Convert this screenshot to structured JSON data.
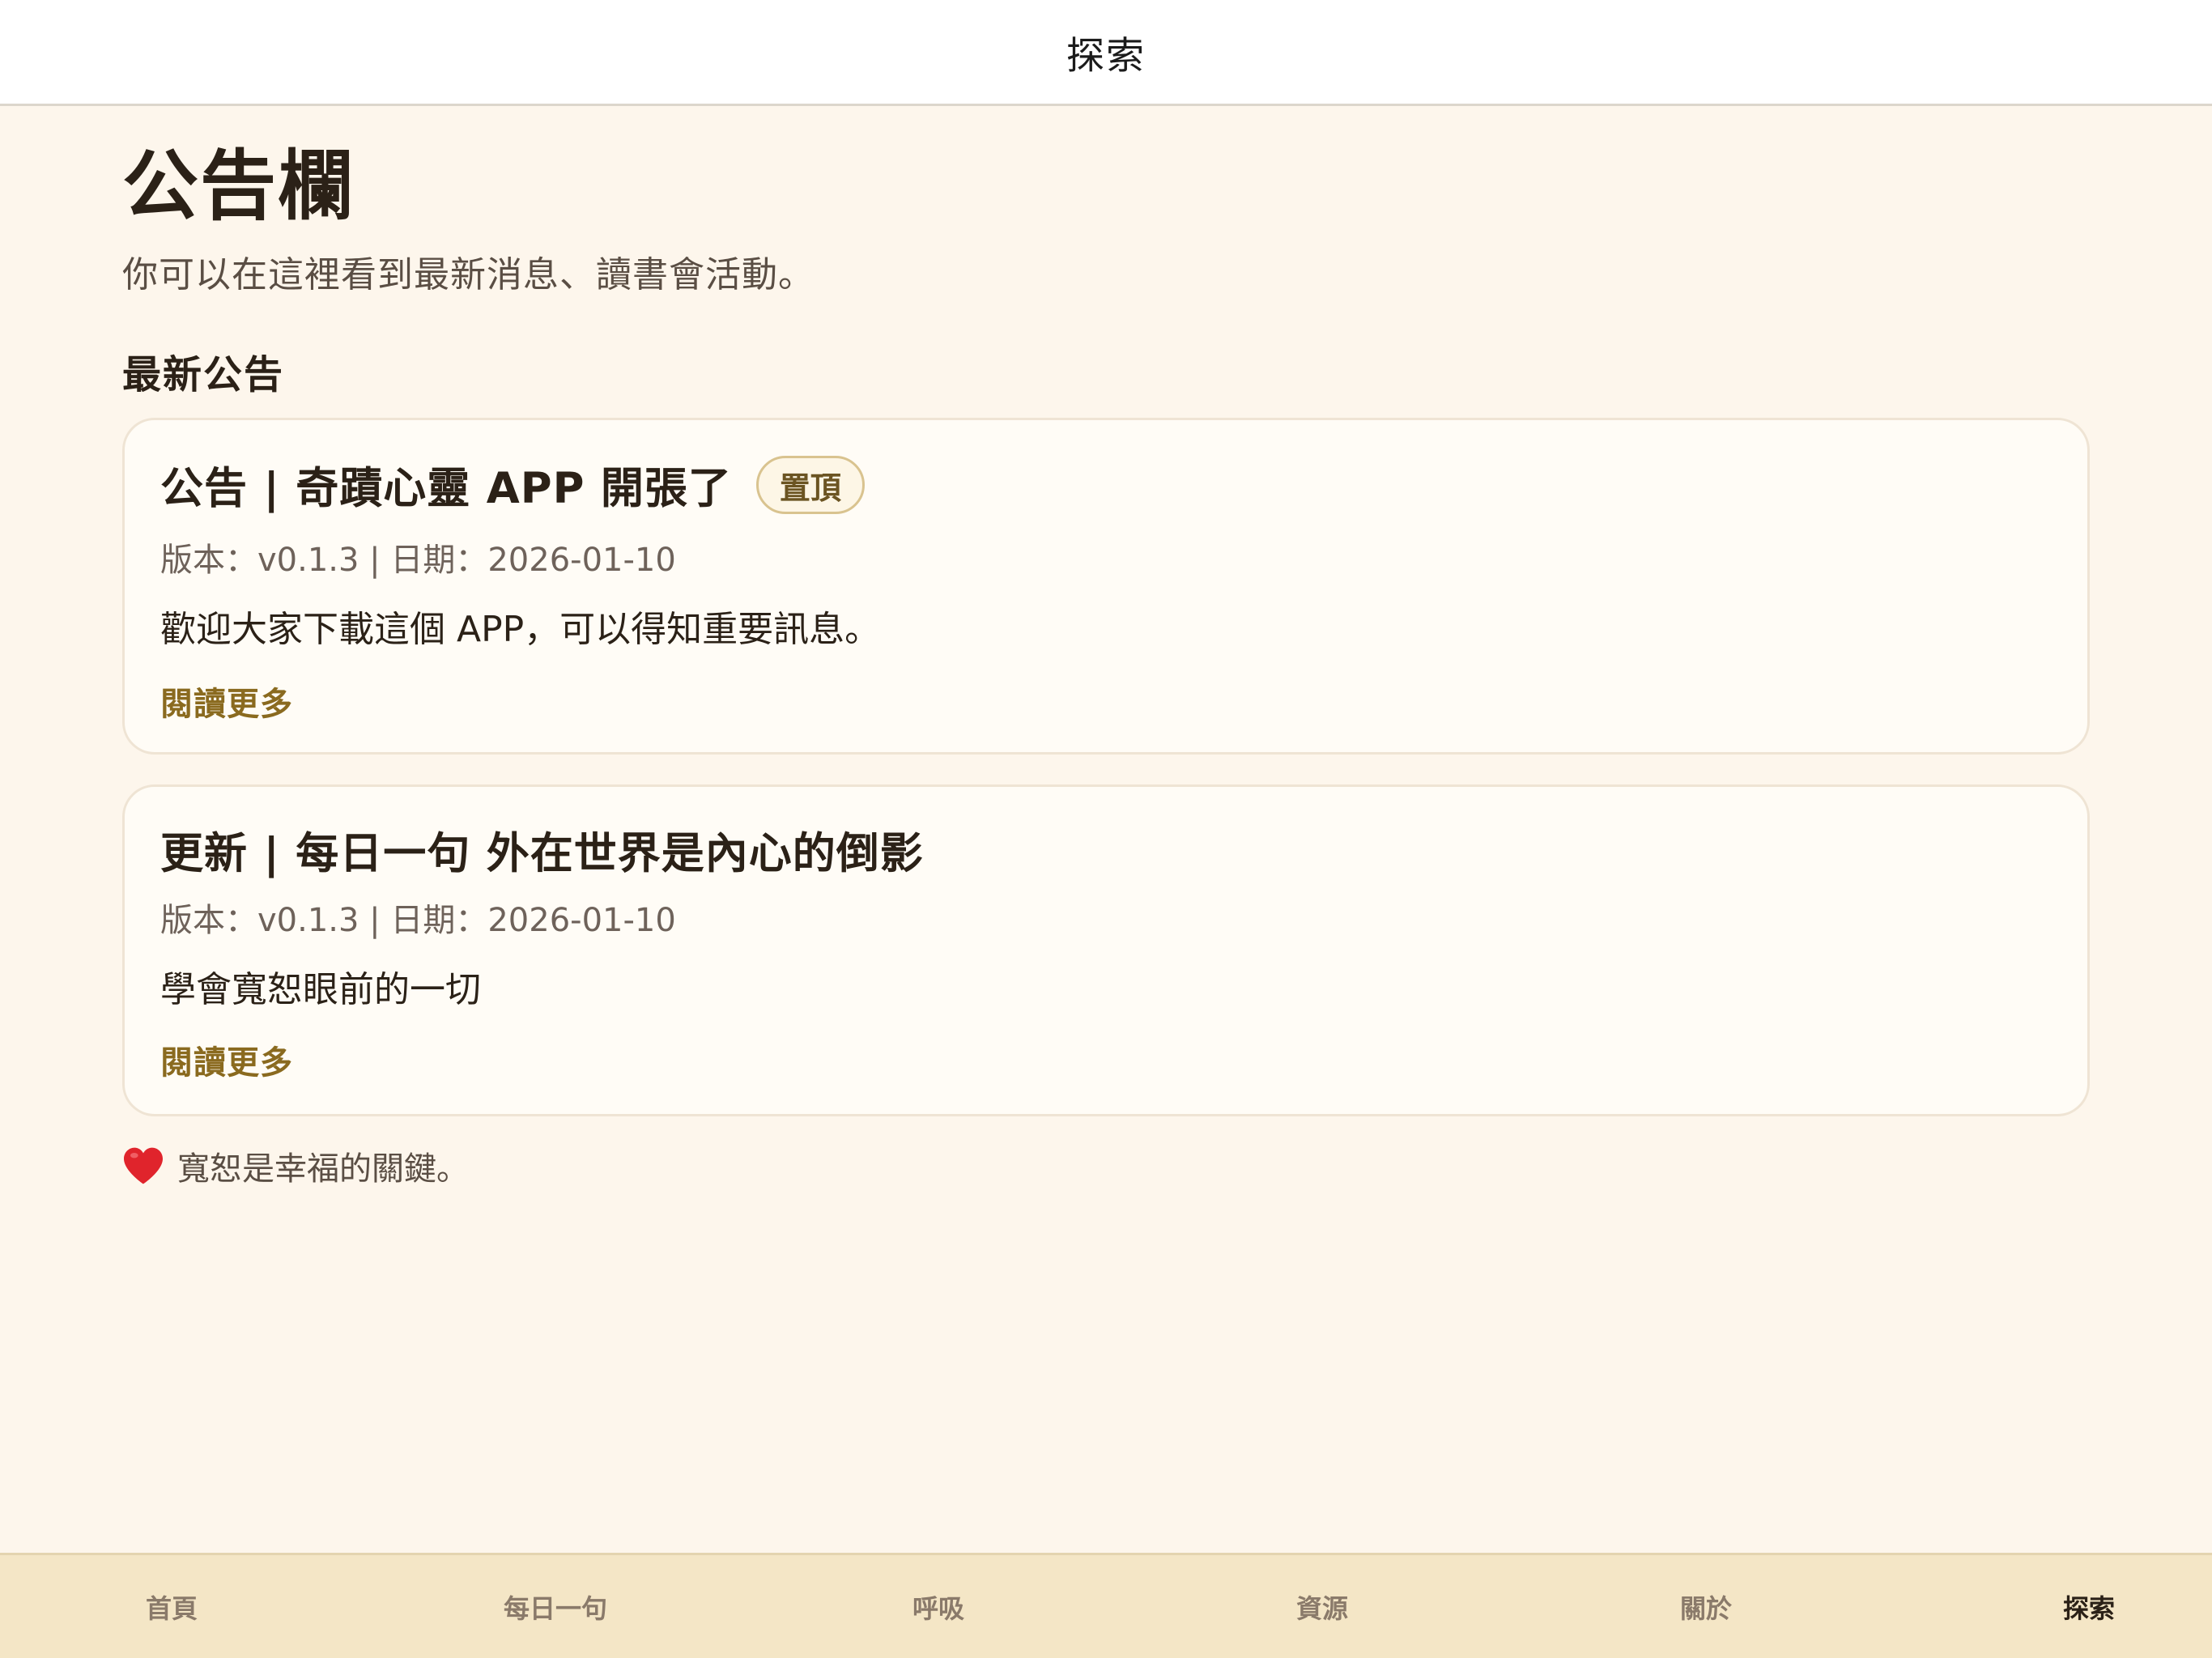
{
  "header": {
    "title": "探索"
  },
  "page": {
    "title": "公告欄",
    "subtitle": "你可以在這裡看到最新消息、讀書會活動。",
    "section_title": "最新公告"
  },
  "announcements": [
    {
      "title": "公告 | 奇蹟心靈 APP 開張了",
      "badge": "置頂",
      "meta": "版本：v0.1.3 | 日期：2026-01-10",
      "body": "歡迎大家下載這個 APP，可以得知重要訊息。",
      "read_more": "閱讀更多"
    },
    {
      "title": "更新 | 每日一句 外在世界是內心的倒影",
      "meta": "版本：v0.1.3 | 日期：2026-01-10",
      "body": "學會寬恕眼前的一切",
      "read_more": "閱讀更多"
    }
  ],
  "footer_note": {
    "icon": "heart-icon",
    "text": "寬恕是幸福的關鍵。"
  },
  "tabs": [
    {
      "label": "首頁",
      "active": false
    },
    {
      "label": "每日一句",
      "active": false
    },
    {
      "label": "呼吸",
      "active": false
    },
    {
      "label": "資源",
      "active": false
    },
    {
      "label": "關於",
      "active": false
    },
    {
      "label": "探索",
      "active": true
    }
  ],
  "colors": {
    "background": "#fdf6ec",
    "card": "#fffcf6",
    "accent": "#8a6a1f",
    "tabbar": "#f4e6c6",
    "heart": "#e0242c"
  }
}
